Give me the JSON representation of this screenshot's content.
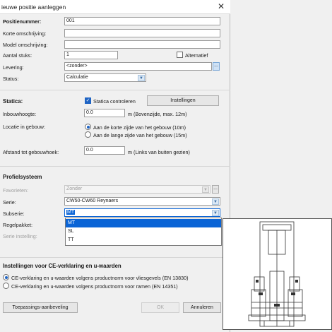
{
  "window": {
    "title": "ieuwe positie aanleggen"
  },
  "fields": {
    "positienummer": {
      "label": "Positienummer:",
      "value": "001"
    },
    "korte_omschrijving": {
      "label": "Korte omschrijving:",
      "value": ""
    },
    "model_omschrijving": {
      "label": "Model omschrijving:",
      "value": ""
    },
    "aantal_stuks": {
      "label": "Aantal stuks:",
      "value": "1"
    },
    "alternatief": {
      "label": "Alternatief",
      "checked": false
    },
    "levering": {
      "label": "Levering:",
      "value": "<zonder>",
      "button": "..."
    },
    "status": {
      "label": "Status:",
      "value": "Calculatie"
    }
  },
  "statica": {
    "title": "Statica:",
    "controleren_label": "Statica controleren",
    "controleren_checked": true,
    "instellingen_button": "Instellingen",
    "inbouwhoogte": {
      "label": "Inbouwhoogte:",
      "value": "0.0",
      "unit": "m (Bovenzijde, max. 12m)"
    },
    "locatie": {
      "label": "Locatie in gebouw:",
      "options": [
        "Aan de korte zijde van het gebouw (10m)",
        "Aan de lange zijde van het gebouw (15m)"
      ],
      "selected": 0
    },
    "afstand": {
      "label": "Afstand tot gebouwhoek:",
      "value": "0.0",
      "unit": "m (Links van buiten gezien)"
    }
  },
  "profielsysteem": {
    "title": "Profielsysteem",
    "favorieten": {
      "label": "Favorieten:",
      "value": "Zonder",
      "button": "..."
    },
    "serie": {
      "label": "Serie:",
      "value": "CW50-CW60 Reynaers"
    },
    "subserie": {
      "label": "Subserie:",
      "value": "MT"
    },
    "regelpakket": {
      "label": "Regelpakket:"
    },
    "serie_instelling": {
      "label": "Serie instelling:"
    },
    "dropdown_options": [
      "MT",
      "SL",
      "TT"
    ],
    "dropdown_selected": 0
  },
  "ce": {
    "title": "Instellingen voor CE-verklaring en u-waarden",
    "options": [
      "CE-verklaring en u-waarden volgens productnorm voor vliesgevels (EN 13830)",
      "CE-verklaring en u-waarden volgens productnorm voor ramen (EN 14351)"
    ],
    "selected": 0
  },
  "footer": {
    "toepassing_button": "Toepassings-aanbeveling",
    "ok_button": "OK",
    "annuleren_button": "Annuleren"
  },
  "colors": {
    "accent": "#1f64c4",
    "highlight": "#0a64d6"
  }
}
